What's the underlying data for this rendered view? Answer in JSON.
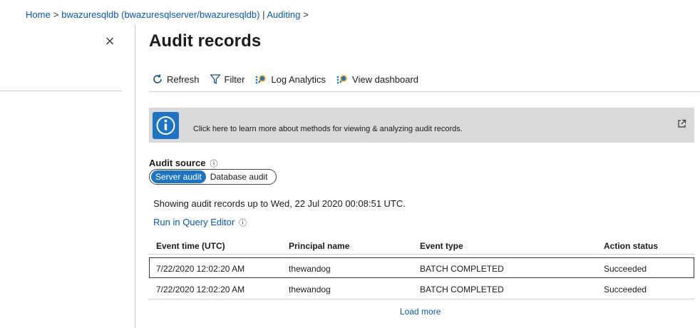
{
  "breadcrumb": {
    "items": [
      "Home",
      "bwazuresqldb (bwazuresqlserver/bwazuresqldb)",
      "Auditing"
    ],
    "separator": ">"
  },
  "blade": {
    "close_glyph": "×"
  },
  "page_title": "Audit records",
  "toolbar": {
    "refresh_label": "Refresh",
    "filter_label": "Filter",
    "log_analytics_label": "Log Analytics",
    "view_dashboard_label": "View dashboard"
  },
  "info_banner": {
    "icon_letter": "i",
    "text": "Click here to learn more about methods for viewing & analyzing audit records."
  },
  "audit_source": {
    "label": "Audit source",
    "info_glyph": "ⓘ",
    "options": [
      "Server audit",
      "Database audit"
    ],
    "selected": "Server audit"
  },
  "showing_text": "Showing audit records up to Wed, 22 Jul 2020 00:08:51 UTC.",
  "run_query_editor": {
    "label": "Run in Query Editor",
    "info_glyph": "ⓘ"
  },
  "table": {
    "columns": [
      "Event time (UTC)",
      "Principal name",
      "Event type",
      "Action status"
    ],
    "rows": [
      [
        "7/22/2020 12:02:20 AM",
        "thewandog",
        "BATCH COMPLETED",
        "Succeeded"
      ],
      [
        "7/22/2020 12:02:20 AM",
        "thewandog",
        "BATCH COMPLETED",
        "Succeeded"
      ]
    ]
  },
  "load_more_label": "Load more",
  "colors": {
    "link": "#0b58a8",
    "accent": "#1f74c2",
    "banner_bg": "#d9d9d9"
  },
  "icons": {
    "refresh": "refresh-icon",
    "filter": "filter-icon",
    "log_analytics": "log-analytics-icon",
    "view_dashboard": "dashboard-icon",
    "info": "info-icon",
    "external_link": "external-link-icon"
  }
}
